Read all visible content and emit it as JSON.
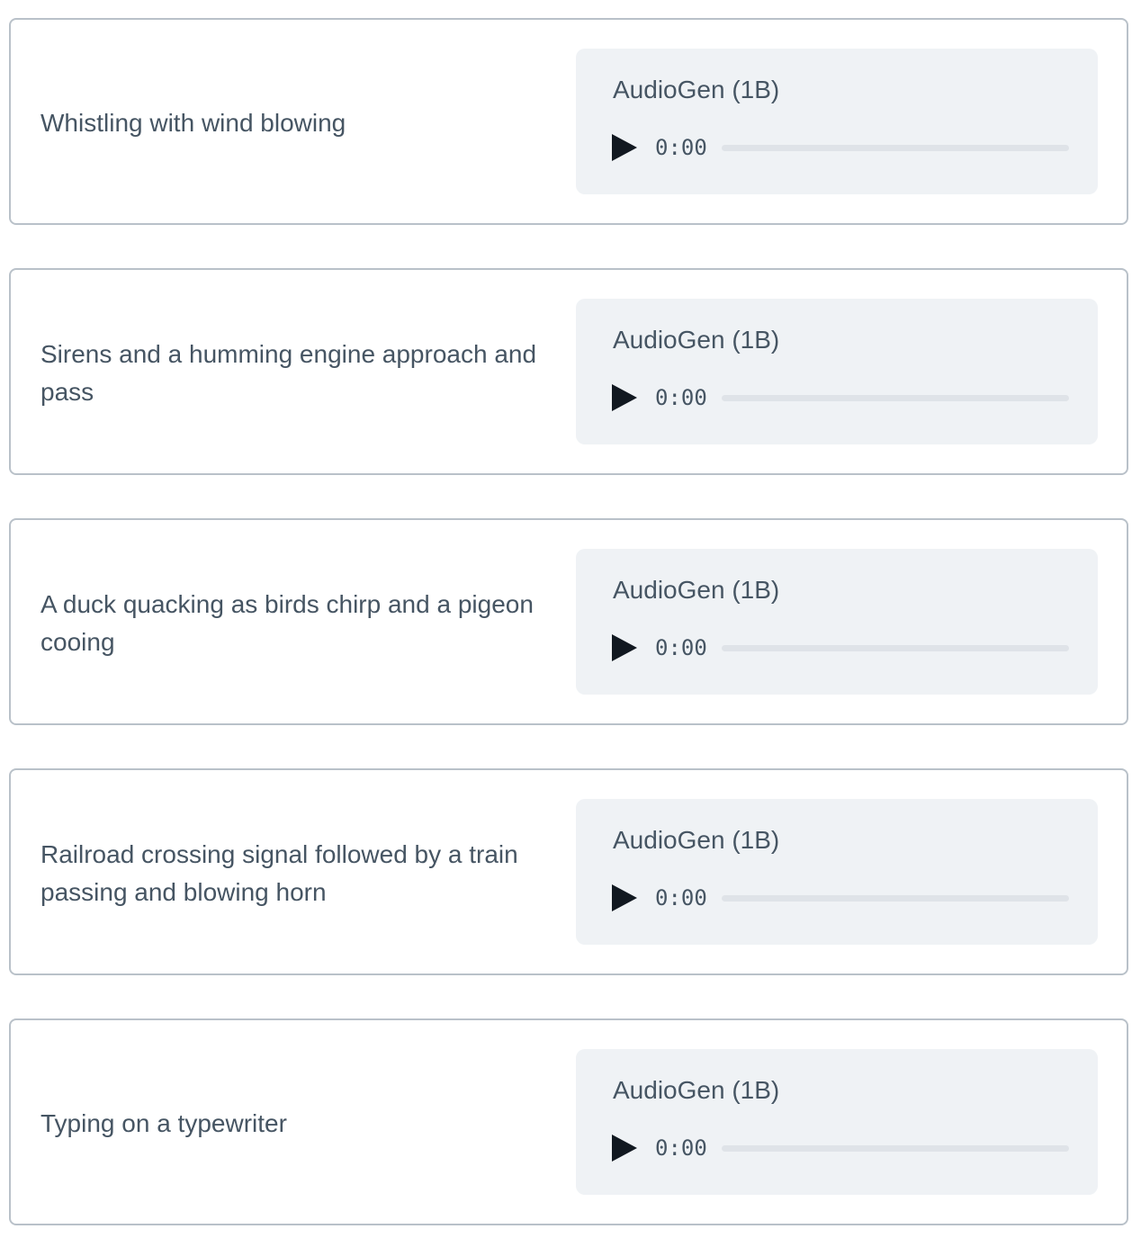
{
  "samples": [
    {
      "prompt": "Whistling with wind blowing",
      "model": "AudioGen (1B)",
      "time": "0:00",
      "play_icon": "play-icon"
    },
    {
      "prompt": "Sirens and a humming engine approach and pass",
      "model": "AudioGen (1B)",
      "time": "0:00",
      "play_icon": "play-icon"
    },
    {
      "prompt": "A duck quacking as birds chirp and a pigeon cooing",
      "model": "AudioGen (1B)",
      "time": "0:00",
      "play_icon": "play-icon"
    },
    {
      "prompt": "Railroad crossing signal followed by a train passing and blowing horn",
      "model": "AudioGen (1B)",
      "time": "0:00",
      "play_icon": "play-icon"
    },
    {
      "prompt": "Typing on a typewriter",
      "model": "AudioGen (1B)",
      "time": "0:00",
      "play_icon": "play-icon"
    }
  ],
  "colors": {
    "border": "#b9c1c9",
    "panel": "#eff2f5",
    "text": "#465563",
    "icon": "#111820",
    "track": "#dfe3e8"
  }
}
